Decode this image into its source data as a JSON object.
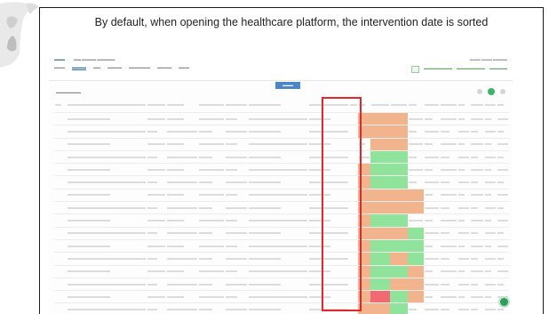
{
  "caption": "By default, when opening the healthcare platform, the intervention date is sorted",
  "colors": {
    "highlight": "#e5262b",
    "orange": "#f2b48c",
    "green": "#8fe39a",
    "red": "#f06a73",
    "primary": "#4d86c7"
  },
  "table": {
    "column_count": 19,
    "rows": [
      {
        "colors": [
          "orange",
          "orange",
          "orange",
          "none"
        ]
      },
      {
        "colors": [
          "orange",
          "orange",
          "orange",
          "none"
        ]
      },
      {
        "colors": [
          "none",
          "orange",
          "orange",
          "none"
        ]
      },
      {
        "colors": [
          "none",
          "green",
          "green",
          "none"
        ]
      },
      {
        "colors": [
          "orange",
          "green",
          "green",
          "none"
        ]
      },
      {
        "colors": [
          "orange",
          "green",
          "green",
          "none"
        ]
      },
      {
        "colors": [
          "orange",
          "orange",
          "orange",
          "orange"
        ]
      },
      {
        "colors": [
          "orange",
          "orange",
          "orange",
          "orange"
        ]
      },
      {
        "colors": [
          "orange",
          "green",
          "green",
          "none"
        ]
      },
      {
        "colors": [
          "orange",
          "orange",
          "orange",
          "green"
        ]
      },
      {
        "colors": [
          "orange",
          "green",
          "green",
          "green"
        ]
      },
      {
        "colors": [
          "orange",
          "green",
          "orange",
          "green"
        ]
      },
      {
        "colors": [
          "orange",
          "green",
          "green",
          "orange"
        ]
      },
      {
        "colors": [
          "orange",
          "green",
          "orange",
          "orange"
        ]
      },
      {
        "colors": [
          "orange",
          "red",
          "green",
          "orange"
        ]
      },
      {
        "colors": [
          "orange",
          "orange",
          "green",
          "none"
        ]
      },
      {
        "colors": [
          "none",
          "green",
          "green",
          "none"
        ]
      }
    ]
  }
}
